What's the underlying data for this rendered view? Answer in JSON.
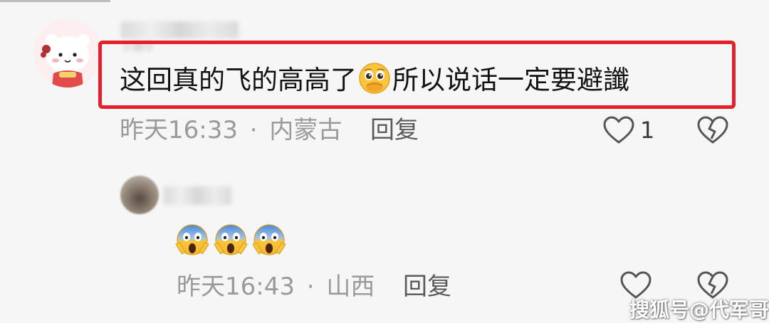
{
  "comments": [
    {
      "text_before_emoji": "这回真的飞的高高了",
      "emoji": "pleading-face-covering-mouth",
      "text_after_emoji": "所以说话一定要避讖",
      "time": "昨天16:33",
      "separator": "·",
      "location": "内蒙古",
      "reply_label": "回复",
      "like_count": "1"
    },
    {
      "emojis": [
        "screaming-face",
        "screaming-face",
        "screaming-face"
      ],
      "time": "昨天16:43",
      "separator": "·",
      "location": "山西",
      "reply_label": "回复"
    }
  ],
  "watermark": "搜狐号@代军哥哥",
  "colors": {
    "highlight_border": "#e5202a",
    "meta_text": "#9a9a9a",
    "background": "#f6f6f6"
  }
}
